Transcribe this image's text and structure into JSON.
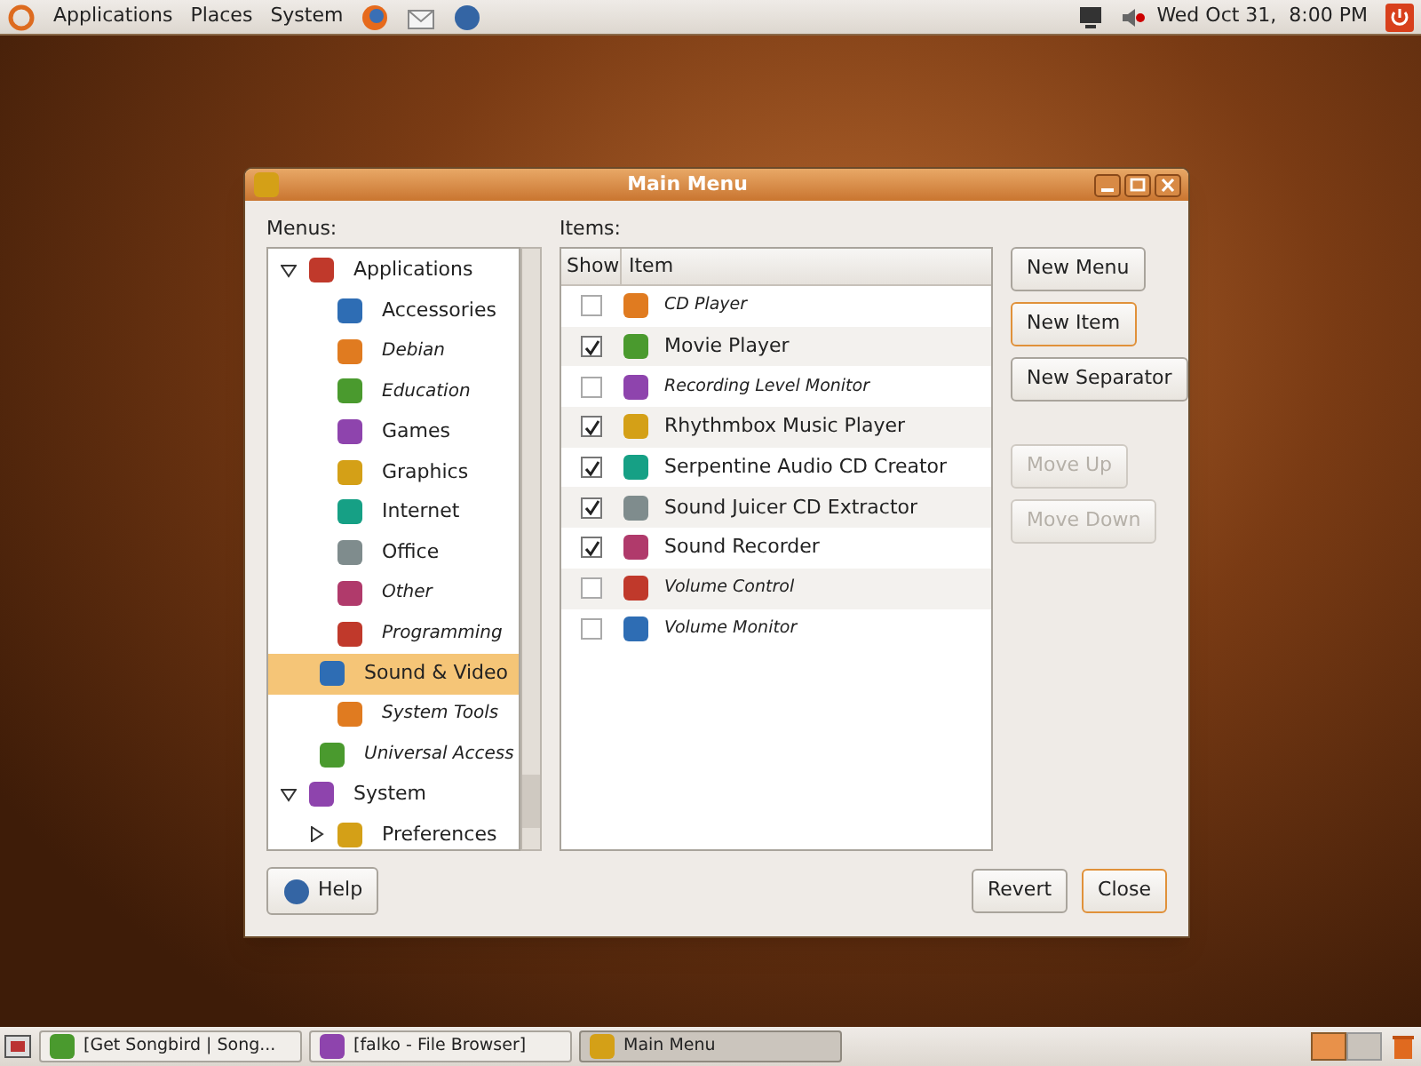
{
  "top_panel": {
    "menus": [
      "Applications",
      "Places",
      "System"
    ],
    "clock": "Wed Oct 31,  8:00 PM"
  },
  "window": {
    "title": "Main Menu",
    "menus_label": "Menus:",
    "menus": [
      {
        "label": "Applications",
        "expanded": true,
        "hidden": false,
        "selected": false,
        "children": [
          {
            "label": "Accessories",
            "hidden": false,
            "selected": false
          },
          {
            "label": "Debian",
            "hidden": true,
            "selected": false
          },
          {
            "label": "Education",
            "hidden": true,
            "selected": false
          },
          {
            "label": "Games",
            "hidden": false,
            "selected": false
          },
          {
            "label": "Graphics",
            "hidden": false,
            "selected": false
          },
          {
            "label": "Internet",
            "hidden": false,
            "selected": false
          },
          {
            "label": "Office",
            "hidden": false,
            "selected": false
          },
          {
            "label": "Other",
            "hidden": true,
            "selected": false
          },
          {
            "label": "Programming",
            "hidden": true,
            "selected": false
          },
          {
            "label": "Sound & Video",
            "hidden": false,
            "selected": true
          },
          {
            "label": "System Tools",
            "hidden": true,
            "selected": false
          },
          {
            "label": "Universal Access",
            "hidden": true,
            "selected": false
          }
        ]
      },
      {
        "label": "System",
        "expanded": true,
        "hidden": false,
        "selected": false,
        "children": [
          {
            "label": "Preferences",
            "expanded": false,
            "hidden": false,
            "selected": false
          }
        ]
      }
    ],
    "items_label": "Items:",
    "columns": [
      "Show",
      "Item"
    ],
    "items": [
      {
        "label": "CD Player",
        "checked": false
      },
      {
        "label": "Movie Player",
        "checked": true
      },
      {
        "label": "Recording Level Monitor",
        "checked": false
      },
      {
        "label": "Rhythmbox Music Player",
        "checked": true
      },
      {
        "label": "Serpentine Audio CD Creator",
        "checked": true
      },
      {
        "label": "Sound Juicer CD Extractor",
        "checked": true
      },
      {
        "label": "Sound Recorder",
        "checked": true
      },
      {
        "label": "Volume Control",
        "checked": false
      },
      {
        "label": "Volume Monitor",
        "checked": false
      }
    ],
    "side_buttons": [
      {
        "label": "New Menu",
        "disabled": false,
        "focused": false
      },
      {
        "label": "New Item",
        "disabled": false,
        "focused": true
      },
      {
        "label": "New Separator",
        "disabled": false,
        "focused": false
      },
      {
        "label": "Move Up",
        "disabled": true,
        "focused": false
      },
      {
        "label": "Move Down",
        "disabled": true,
        "focused": false
      }
    ],
    "help_button": "Help",
    "bottom_buttons": [
      {
        "label": "Revert",
        "focused": false
      },
      {
        "label": "Close",
        "focused": true
      }
    ]
  },
  "taskbar": [
    {
      "label": "[Get Songbird | Song...",
      "selected": false
    },
    {
      "label": "[falko - File Browser]",
      "selected": false
    },
    {
      "label": "Main Menu",
      "selected": true
    }
  ]
}
